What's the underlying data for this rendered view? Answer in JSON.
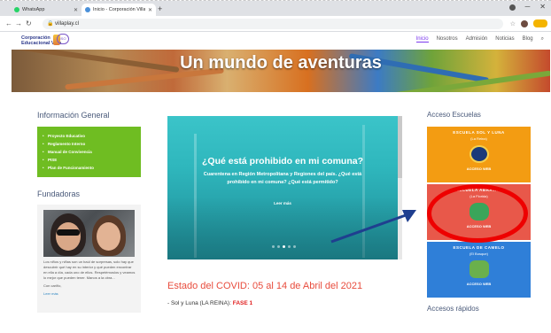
{
  "browser": {
    "tabs": [
      {
        "title": "WhatsApp",
        "active": false
      },
      {
        "title": "Inicio - Corporación Villaplay",
        "active": true
      }
    ],
    "new_tab": "+",
    "url": "villaplay.cl",
    "window_controls": {
      "minimize": "─",
      "close": "✕"
    }
  },
  "site": {
    "logo_text": "Corporación Educacional Villa",
    "logo_badge": "ISO",
    "nav": [
      "Inicio",
      "Nosotros",
      "Admisión",
      "Noticias",
      "Blog"
    ],
    "nav_active": "Inicio",
    "hero_title": "Un mundo de aventuras"
  },
  "left": {
    "info_title": "Información General",
    "info_items": [
      "Proyecto Educativo",
      "Reglamento Interno",
      "Manual de Convivencia",
      "PISE",
      "Plan de Funcionamiento"
    ],
    "founders_title": "Fundadoras",
    "founders_text": "Los niños y niñas son un baúl de sorpresas, solo hay que descubrir qué hay en su interior y qué pueden encontrar en ella a día, cada uno de ellos. Respetémoslos y veamos lo mejor que pueden tener. Manos a la obra...",
    "founders_signature": "Con cariño,",
    "founders_more": "Leer más"
  },
  "carousel": {
    "title": "¿Qué está prohibido en mi comuna?",
    "text": "Cuarentena en Región Metropolitana y Regiones del país. ¿Qué está prohibido en mi comuna? ¿Qué está permitido?",
    "read_more": "Leer más",
    "slides": 5,
    "current_slide": 3
  },
  "covid": {
    "title": "Estado del COVID: 05 al 14 de Abril del 2021",
    "line_prefix": "- Sol y Luna (LA REINA): ",
    "line_phase": "FASE 1"
  },
  "right": {
    "schools_title": "Acceso Escuelas",
    "schools": [
      {
        "name": "ESCUELA SOL Y LUNA",
        "location": "(La Reina)",
        "access": "ACCESO WEB",
        "color": "#f39c12"
      },
      {
        "name": "ESCUELA ABRAYAN",
        "location": "(La Florida)",
        "access": "ACCESO WEB",
        "color": "#e8584a"
      },
      {
        "name": "ESCUELA DE CAMELO",
        "location": "(El Bosque)",
        "access": "ACCESO WEB",
        "color": "#2f7fd8"
      }
    ],
    "quick_title": "Accesos rápidos"
  },
  "colors": {
    "accent": "#7c3aed",
    "info_box": "#6fbd22",
    "covid_title": "#e84c3d",
    "phase": "#e02020",
    "annotation": "#ee0000",
    "arrow": "#1f3f8f"
  }
}
